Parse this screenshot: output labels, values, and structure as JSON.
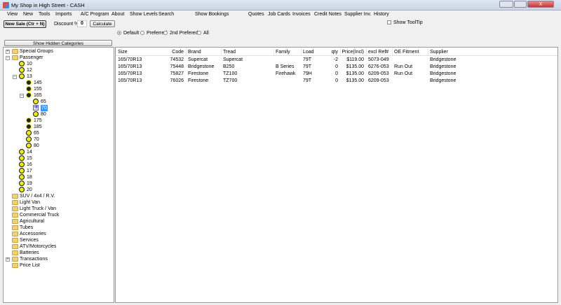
{
  "window": {
    "title": "My Shop in High Street - CASH",
    "close_label": "X"
  },
  "menu": [
    "View",
    "New",
    "Tools",
    "Imports",
    "A/C Program",
    "About",
    "Show Levels",
    "Search",
    "Show Bookings",
    "Quotes",
    "Job Cards",
    "Invoices",
    "Credit Notes",
    "Supplier Inv.",
    "History"
  ],
  "toolbar": {
    "new_sale": "New Sale (Ctr + N)",
    "discount_label": "Discount %",
    "discount_value": "0",
    "calculate": "Calculate",
    "show_tooltip": "Show ToolTip",
    "show_tooltip_checked": false
  },
  "radios": {
    "options": [
      "Default",
      "Preferred",
      "2nd Prefered",
      "All"
    ],
    "selected": "Default"
  },
  "show_hidden": "Show Hidden Categories",
  "tree": [
    {
      "label": "Special Groups",
      "level": 0,
      "icon": "folder",
      "exp": "+"
    },
    {
      "label": "Passenger",
      "level": 0,
      "icon": "folder",
      "exp": "-"
    },
    {
      "label": "10",
      "level": 1,
      "icon": "tyre"
    },
    {
      "label": "12",
      "level": 1,
      "icon": "tyre"
    },
    {
      "label": "13",
      "level": 1,
      "icon": "tyre",
      "exp": "-"
    },
    {
      "label": "145",
      "level": 2,
      "icon": "tyre-dark"
    },
    {
      "label": "155",
      "level": 2,
      "icon": "tyre-dark"
    },
    {
      "label": "165",
      "level": 2,
      "icon": "tyre-dark",
      "exp": "-"
    },
    {
      "label": "65",
      "level": 3,
      "icon": "tyre"
    },
    {
      "label": "70",
      "level": 3,
      "icon": "arrow",
      "selected": true
    },
    {
      "label": "80",
      "level": 3,
      "icon": "tyre"
    },
    {
      "label": "175",
      "level": 2,
      "icon": "tyre-dark"
    },
    {
      "label": "185",
      "level": 2,
      "icon": "tyre-dark"
    },
    {
      "label": "65",
      "level": 2,
      "icon": "tyre"
    },
    {
      "label": "70",
      "level": 2,
      "icon": "tyre"
    },
    {
      "label": "80",
      "level": 2,
      "icon": "tyre"
    },
    {
      "label": "14",
      "level": 1,
      "icon": "tyre"
    },
    {
      "label": "15",
      "level": 1,
      "icon": "tyre"
    },
    {
      "label": "16",
      "level": 1,
      "icon": "tyre"
    },
    {
      "label": "17",
      "level": 1,
      "icon": "tyre"
    },
    {
      "label": "18",
      "level": 1,
      "icon": "tyre"
    },
    {
      "label": "19",
      "level": 1,
      "icon": "tyre"
    },
    {
      "label": "20",
      "level": 1,
      "icon": "tyre"
    },
    {
      "label": "SUV / 4x4 / R.V.",
      "level": 0,
      "icon": "folder"
    },
    {
      "label": "Light Van",
      "level": 0,
      "icon": "folder"
    },
    {
      "label": "Light Truck / Van",
      "level": 0,
      "icon": "folder"
    },
    {
      "label": "Commercial Truck",
      "level": 0,
      "icon": "folder"
    },
    {
      "label": "Agricultural",
      "level": 0,
      "icon": "folder"
    },
    {
      "label": "Tubes",
      "level": 0,
      "icon": "folder"
    },
    {
      "label": "Accessories",
      "level": 0,
      "icon": "folder"
    },
    {
      "label": "Services",
      "level": 0,
      "icon": "folder"
    },
    {
      "label": "ATV/Motorcycles",
      "level": 0,
      "icon": "folder"
    },
    {
      "label": "Batteries",
      "level": 0,
      "icon": "folder"
    },
    {
      "label": "Transactions",
      "level": 0,
      "icon": "folder",
      "exp": "+"
    },
    {
      "label": "Price List",
      "level": 0,
      "icon": "folder"
    }
  ],
  "grid": {
    "columns": [
      "Size",
      "Code",
      "Brand",
      "Tread",
      "Family",
      "Load",
      "qty",
      "Price(Incl)",
      "excl Ref#",
      "OE Fitment",
      "Supplier"
    ],
    "rows": [
      [
        "165/70R13",
        "74532",
        "Supercat",
        "Supercat",
        "",
        "79T",
        "-2",
        "$119.00",
        "5073-049",
        "",
        "Bridgestone"
      ],
      [
        "165/70R13",
        "75448",
        "Bridgestone",
        "B250",
        "B Series",
        "79T",
        "0",
        "$135.00",
        "6276-053",
        "Run Out",
        "Bridgestone"
      ],
      [
        "165/70R13",
        "75827",
        "Firestone",
        "TZ100",
        "Firehawk",
        "79H",
        "0",
        "$135.00",
        "6209-053",
        "Run Out",
        "Bridgestone"
      ],
      [
        "165/70R13",
        "76026",
        "Firestone",
        "TZ700",
        "",
        "79T",
        "0",
        "$135.00",
        "6209-053",
        "",
        "Bridgestone"
      ]
    ]
  }
}
